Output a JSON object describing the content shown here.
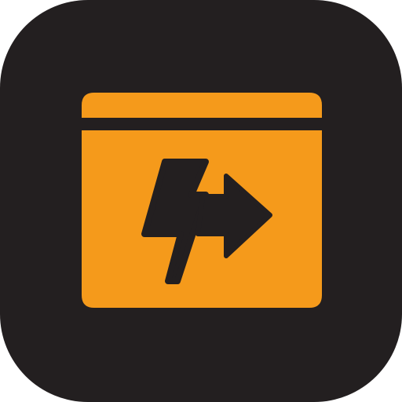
{
  "icon": {
    "name": "browser-window-lightning-arrow-icon",
    "background_color": "#231f20",
    "window_color": "#f59a1b",
    "glyph_color": "#231f20"
  }
}
